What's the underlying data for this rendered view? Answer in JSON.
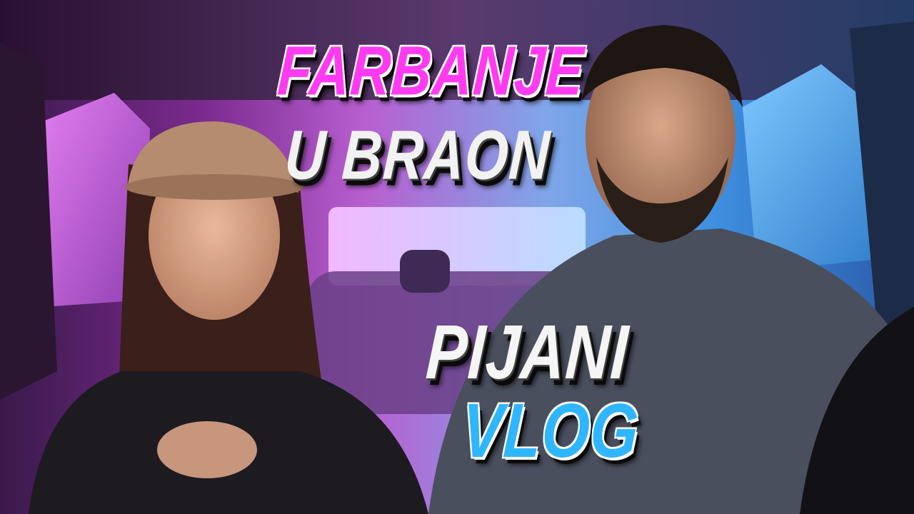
{
  "thumbnail": {
    "line1": "FARBANJE",
    "line2": "U BRAON",
    "line3": "PIJANI",
    "line4": "VLOG"
  },
  "colors": {
    "accent_pink": "#ff3bf2",
    "accent_blue": "#2fb6ff",
    "text_white": "#f2f2f2"
  }
}
